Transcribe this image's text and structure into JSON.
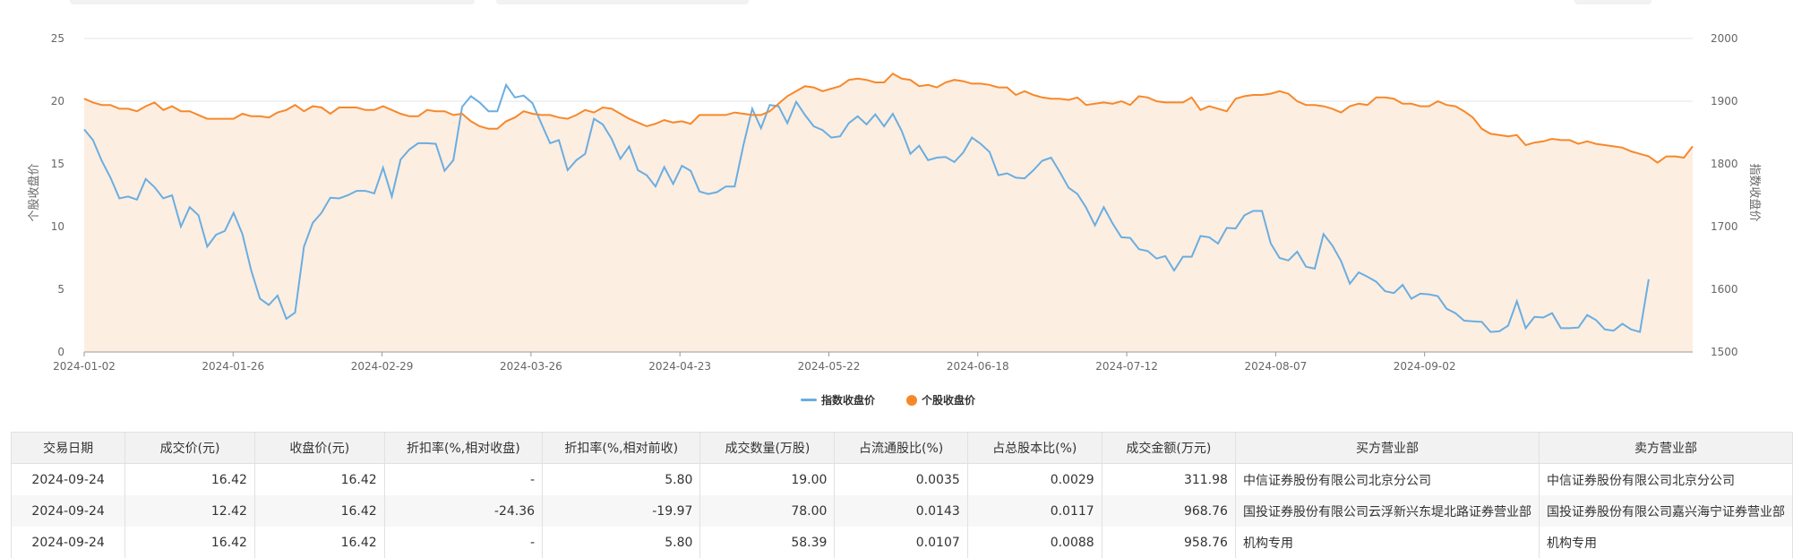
{
  "colors": {
    "index_line": "#6aaee0",
    "stock_line": "#f7882a",
    "area_fill": "#fdeee2",
    "grid": "#e6e6e6",
    "axis": "#999999"
  },
  "chart_data": {
    "type": "line",
    "x_tick_labels": [
      "2024-01-02",
      "2024-01-26",
      "2024-02-29",
      "2024-03-26",
      "2024-04-23",
      "2024-05-22",
      "2024-06-18",
      "2024-07-12",
      "2024-08-07",
      "2024-09-02"
    ],
    "y_left": {
      "label": "个股收盘价",
      "ylim": [
        0,
        25
      ],
      "ticks": [
        0,
        5,
        10,
        15,
        20,
        25
      ]
    },
    "y_right": {
      "label": "指数收盘价",
      "ylim": [
        1500,
        2000
      ],
      "ticks": [
        1500,
        1600,
        1700,
        1800,
        1900,
        2000
      ]
    },
    "grid": true,
    "legend_position": "bottom-center",
    "series": [
      {
        "name": "指数收盘价",
        "axis": "right",
        "values": [
          1855,
          1838,
          1805,
          1778,
          1745,
          1748,
          1743,
          1776,
          1763,
          1745,
          1750,
          1700,
          1731,
          1718,
          1668,
          1687,
          1693,
          1722,
          1688,
          1630,
          1585,
          1575,
          1590,
          1553,
          1563,
          1668,
          1706,
          1722,
          1746,
          1745,
          1750,
          1757,
          1757,
          1753,
          1794,
          1748,
          1807,
          1823,
          1833,
          1833,
          1832,
          1789,
          1806,
          1891,
          1908,
          1898,
          1884,
          1884,
          1926,
          1906,
          1909,
          1897,
          1865,
          1833,
          1838,
          1790,
          1806,
          1816,
          1872,
          1863,
          1840,
          1808,
          1828,
          1790,
          1782,
          1764,
          1795,
          1768,
          1797,
          1789,
          1756,
          1752,
          1755,
          1764,
          1764,
          1830,
          1888,
          1857,
          1894,
          1892,
          1865,
          1899,
          1878,
          1860,
          1854,
          1842,
          1844,
          1865,
          1876,
          1863,
          1879,
          1860,
          1880,
          1853,
          1816,
          1829,
          1806,
          1810,
          1811,
          1803,
          1818,
          1842,
          1832,
          1819,
          1782,
          1785,
          1778,
          1777,
          1790,
          1805,
          1810,
          1787,
          1762,
          1752,
          1730,
          1702,
          1731,
          1705,
          1683,
          1682,
          1664,
          1661,
          1649,
          1653,
          1630,
          1652,
          1652,
          1685,
          1683,
          1673,
          1698,
          1697,
          1718,
          1725,
          1725,
          1673,
          1650,
          1646,
          1660,
          1636,
          1633,
          1688,
          1670,
          1645,
          1609,
          1627,
          1620,
          1612,
          1597,
          1594,
          1607,
          1585,
          1593,
          1592,
          1589,
          1569,
          1562,
          1550,
          1549,
          1548,
          1532,
          1533,
          1542,
          1581,
          1538,
          1556,
          1555,
          1562,
          1538,
          1538,
          1539,
          1559,
          1551,
          1536,
          1534,
          1545,
          1536,
          1532,
          1616
        ]
      },
      {
        "name": "个股收盘价",
        "axis": "left",
        "values": [
          20.2,
          19.9,
          19.7,
          19.7,
          19.4,
          19.4,
          19.2,
          19.6,
          19.9,
          19.3,
          19.6,
          19.2,
          19.2,
          18.9,
          18.6,
          18.6,
          18.6,
          18.6,
          19.0,
          18.8,
          18.8,
          18.7,
          19.1,
          19.3,
          19.7,
          19.2,
          19.6,
          19.5,
          19.0,
          19.5,
          19.5,
          19.5,
          19.3,
          19.3,
          19.6,
          19.3,
          19.0,
          18.8,
          18.8,
          19.3,
          19.2,
          19.2,
          18.9,
          19.0,
          18.4,
          18.0,
          17.8,
          17.8,
          18.4,
          18.7,
          19.2,
          19.0,
          18.9,
          18.9,
          18.7,
          18.6,
          18.9,
          19.3,
          19.1,
          19.5,
          19.4,
          19.0,
          18.6,
          18.3,
          18.0,
          18.2,
          18.5,
          18.3,
          18.4,
          18.2,
          18.9,
          18.9,
          18.9,
          18.9,
          19.1,
          19.0,
          18.9,
          18.9,
          19.2,
          19.8,
          20.4,
          20.8,
          21.2,
          21.1,
          20.8,
          21.0,
          21.2,
          21.7,
          21.8,
          21.7,
          21.5,
          21.5,
          22.2,
          21.8,
          21.7,
          21.2,
          21.3,
          21.1,
          21.5,
          21.7,
          21.6,
          21.4,
          21.4,
          21.3,
          21.1,
          21.1,
          20.5,
          20.8,
          20.5,
          20.3,
          20.2,
          20.2,
          20.1,
          20.3,
          19.7,
          19.8,
          19.9,
          19.8,
          20.0,
          19.7,
          20.4,
          20.3,
          20.0,
          19.9,
          19.9,
          19.9,
          20.3,
          19.3,
          19.6,
          19.4,
          19.2,
          20.2,
          20.4,
          20.5,
          20.5,
          20.6,
          20.8,
          20.6,
          20.0,
          19.7,
          19.7,
          19.6,
          19.4,
          19.1,
          19.6,
          19.8,
          19.7,
          20.3,
          20.3,
          20.2,
          19.8,
          19.8,
          19.6,
          19.6,
          20.0,
          19.7,
          19.6,
          19.2,
          18.7,
          17.8,
          17.4,
          17.3,
          17.2,
          17.3,
          16.5,
          16.7,
          16.8,
          17.0,
          16.9,
          16.9,
          16.6,
          16.8,
          16.6,
          16.5,
          16.4,
          16.3,
          16.0,
          15.8,
          15.6,
          15.1,
          15.6,
          15.6,
          15.5,
          16.4
        ]
      }
    ]
  },
  "legend": {
    "index_label": "指数收盘价",
    "stock_label": "个股收盘价"
  },
  "table": {
    "headers": [
      "交易日期",
      "成交价(元)",
      "收盘价(元)",
      "折扣率(%,相对收盘)",
      "折扣率(%,相对前收)",
      "成交数量(万股)",
      "占流通股比(%)",
      "占总股本比(%)",
      "成交金额(万元)",
      "买方营业部",
      "卖方营业部"
    ],
    "rows": [
      [
        "2024-09-24",
        "16.42",
        "16.42",
        "-",
        "5.80",
        "19.00",
        "0.0035",
        "0.0029",
        "311.98",
        "中信证券股份有限公司北京分公司",
        "中信证券股份有限公司北京分公司"
      ],
      [
        "2024-09-24",
        "12.42",
        "16.42",
        "-24.36",
        "-19.97",
        "78.00",
        "0.0143",
        "0.0117",
        "968.76",
        "国投证券股份有限公司云浮新兴东堤北路证券营业部",
        "国投证券股份有限公司嘉兴海宁证券营业部"
      ],
      [
        "2024-09-24",
        "16.42",
        "16.42",
        "-",
        "5.80",
        "58.39",
        "0.0107",
        "0.0088",
        "958.76",
        "机构专用",
        "机构专用"
      ]
    ]
  }
}
